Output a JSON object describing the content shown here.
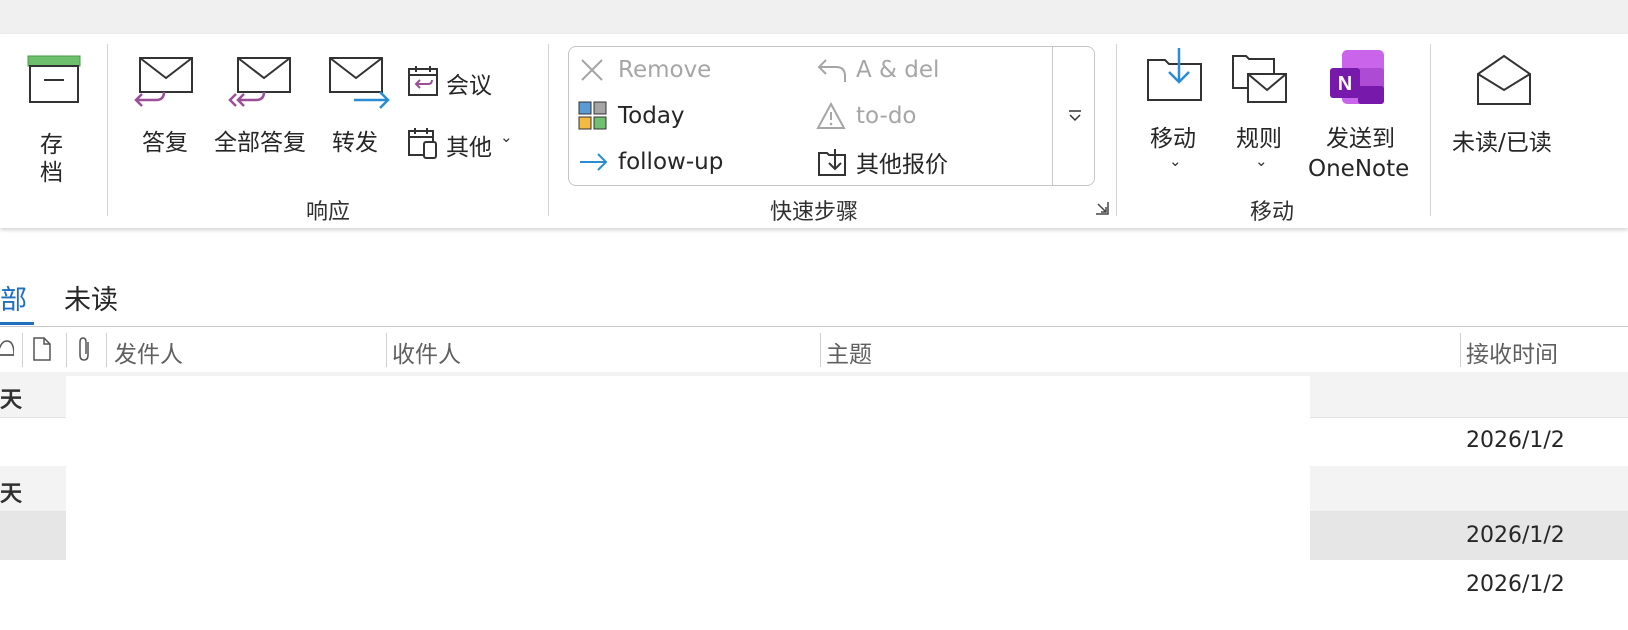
{
  "ribbon": {
    "archive": {
      "label_line1": "存",
      "label_line2": "档"
    },
    "respond": {
      "group_label": "响应",
      "reply": "答复",
      "reply_all": "全部答复",
      "forward": "转发",
      "meeting": "会议",
      "more": "其他",
      "more_chevron": "⌄"
    },
    "quick_steps": {
      "group_label": "快速步骤",
      "items": [
        {
          "label": "Remove",
          "enabled": false
        },
        {
          "label": "A & del",
          "enabled": false
        },
        {
          "label": "Today",
          "enabled": true
        },
        {
          "label": "to-do",
          "enabled": false
        },
        {
          "label": "follow-up",
          "enabled": true
        },
        {
          "label": "其他报价",
          "enabled": true
        }
      ],
      "expand_glyph": "⩡",
      "launcher_glyph": "⌟"
    },
    "move": {
      "group_label": "移动",
      "move": "移动",
      "move_chevron": "⌄",
      "rules": "规则",
      "rules_chevron": "⌄",
      "onenote_line1": "发送到",
      "onenote_line2": "OneNote",
      "onenote_letter": "N"
    },
    "tags": {
      "read_unread": "未读/已读"
    }
  },
  "filter_tabs": {
    "all": "部",
    "unread": "未读"
  },
  "columns": {
    "from": "发件人",
    "to": "收件人",
    "subject": "主题",
    "received": "接收时间"
  },
  "groups": [
    {
      "title": "天"
    },
    {
      "title": "天"
    }
  ],
  "rows": [
    {
      "received": "2026/1/2"
    },
    {
      "received": "2026/1/2"
    },
    {
      "received": "2026/1/2"
    }
  ],
  "colors": {
    "archive_green": "#6dbe6d",
    "reply_purple": "#9b4f96",
    "forward_blue": "#2a8dd4",
    "active_tab_blue": "#1e6fbf",
    "onenote_purple": "#7719aa"
  }
}
